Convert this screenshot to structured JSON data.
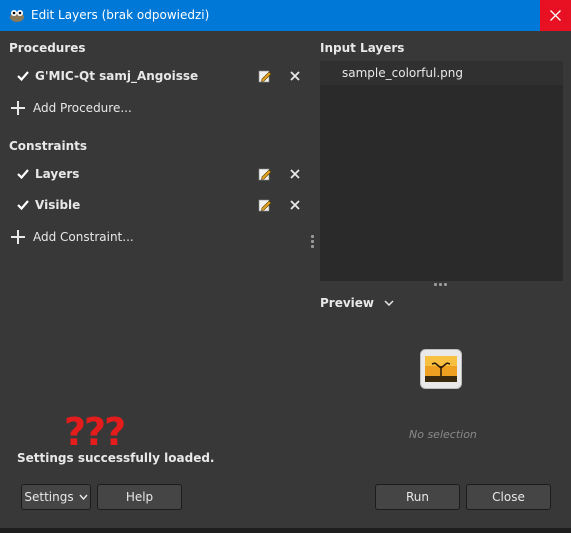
{
  "window": {
    "title": "Edit Layers (brak odpowiedzi)"
  },
  "procedures": {
    "title": "Procedures",
    "items": [
      {
        "label": "G'MIC-Qt samj_Angoisse",
        "checked": true
      }
    ],
    "add_label": "Add Procedure..."
  },
  "constraints": {
    "title": "Constraints",
    "items": [
      {
        "label": "Layers",
        "checked": true
      },
      {
        "label": "Visible",
        "checked": true
      }
    ],
    "add_label": "Add Constraint..."
  },
  "input_layers": {
    "title": "Input Layers",
    "items": [
      {
        "label": "sample_colorful.png"
      }
    ]
  },
  "preview": {
    "title": "Preview",
    "empty_text": "No selection"
  },
  "annotation": {
    "text": "???"
  },
  "status": {
    "text": "Settings successfully loaded."
  },
  "buttons": {
    "settings": "Settings",
    "help": "Help",
    "run": "Run",
    "close": "Close"
  },
  "colors": {
    "titlebar": "#0078d7",
    "close_hover": "#e81123",
    "panel": "#383838",
    "annotation": "#e41c1c"
  },
  "icons": {
    "app": "gimp-wilber-icon",
    "edit": "edit-icon",
    "remove": "close-x-icon",
    "check": "checkmark-icon",
    "add": "plus-icon",
    "thumbnail": "image-thumbnail-icon"
  }
}
